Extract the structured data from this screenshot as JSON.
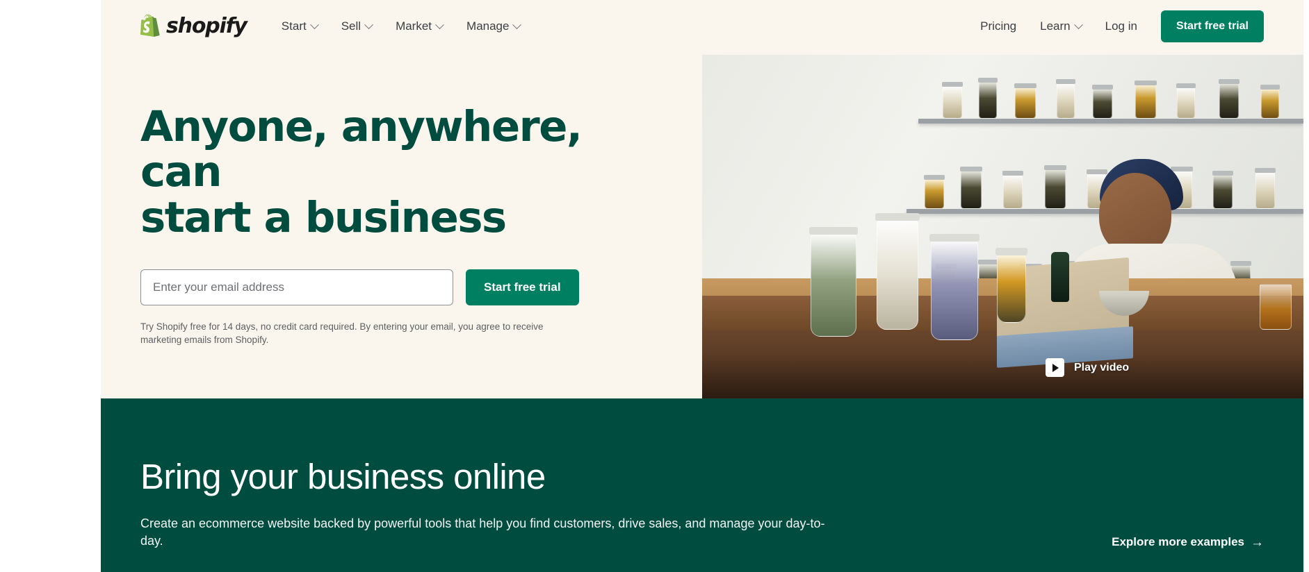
{
  "brand": {
    "logo_word": "shopify",
    "logo_icon": "shopify-bag-icon",
    "accent_green": "#008060",
    "dark_green": "#004c3f",
    "cream": "#faf6ed"
  },
  "header": {
    "nav_main": [
      {
        "label": "Start",
        "has_chevron": true
      },
      {
        "label": "Sell",
        "has_chevron": true
      },
      {
        "label": "Market",
        "has_chevron": true
      },
      {
        "label": "Manage",
        "has_chevron": true
      }
    ],
    "nav_right": [
      {
        "label": "Pricing",
        "has_chevron": false
      },
      {
        "label": "Learn",
        "has_chevron": true
      },
      {
        "label": "Log in",
        "has_chevron": false
      }
    ],
    "cta_label": "Start free trial"
  },
  "hero": {
    "title_line1": "Anyone, anywhere, can",
    "title_line2": "start a business",
    "email_placeholder": "Enter your email address",
    "email_value": "",
    "cta_label": "Start free trial",
    "disclaimer": "Try Shopify free for 14 days, no credit card required. By entering your email, you agree to receive marketing emails from Shopify.",
    "play_label": "Play video",
    "play_icon": "play-triangle-icon"
  },
  "promo": {
    "title": "Bring your business online",
    "subtitle": "Create an ecommerce website backed by powerful tools that help you find customers, drive sales, and manage your day-to-day.",
    "link_label": "Explore more examples",
    "link_arrow": "→"
  }
}
